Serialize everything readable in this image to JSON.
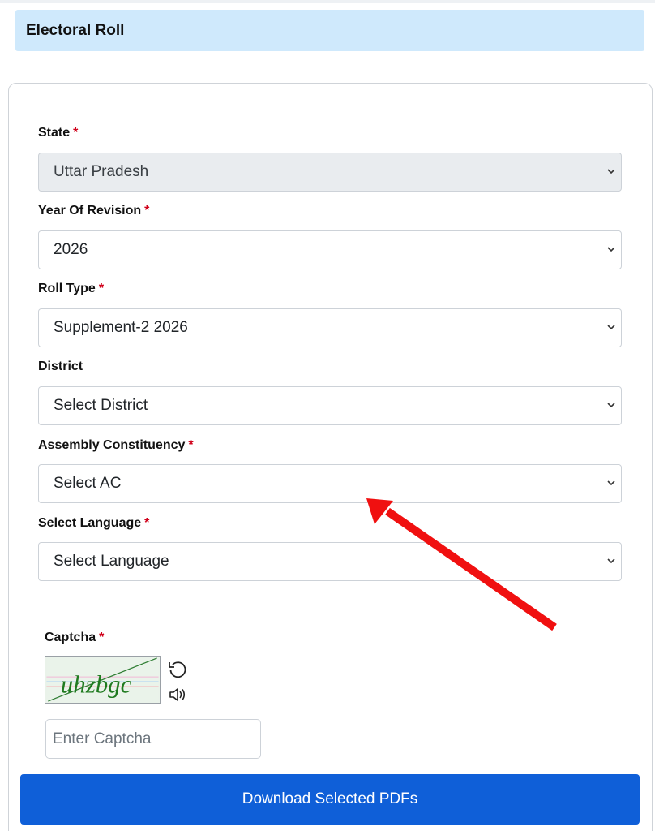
{
  "header": {
    "title": "Electoral Roll"
  },
  "form": {
    "required_mark": "*",
    "state": {
      "label": "State",
      "value": "Uttar Pradesh"
    },
    "year": {
      "label": "Year Of Revision",
      "value": "2026"
    },
    "roll_type": {
      "label": "Roll Type",
      "value": "Supplement-2 2026"
    },
    "district": {
      "label": "District",
      "value": "Select District"
    },
    "ac": {
      "label": "Assembly Constituency",
      "value": "Select AC"
    },
    "language": {
      "label": "Select Language",
      "value": "Select Language"
    }
  },
  "captcha": {
    "label": "Captcha",
    "image_text": "uhzbgc",
    "input_placeholder": "Enter Captcha"
  },
  "actions": {
    "download_label": "Download Selected PDFs"
  },
  "colors": {
    "header_bg": "#cfe9fc",
    "required": "#d0021b",
    "primary_button": "#0f5fd8",
    "annotation_arrow": "#f01010"
  },
  "icons": {
    "select_chevron": "chevron-down-icon",
    "captcha_refresh": "refresh-icon",
    "captcha_audio": "speaker-icon"
  }
}
